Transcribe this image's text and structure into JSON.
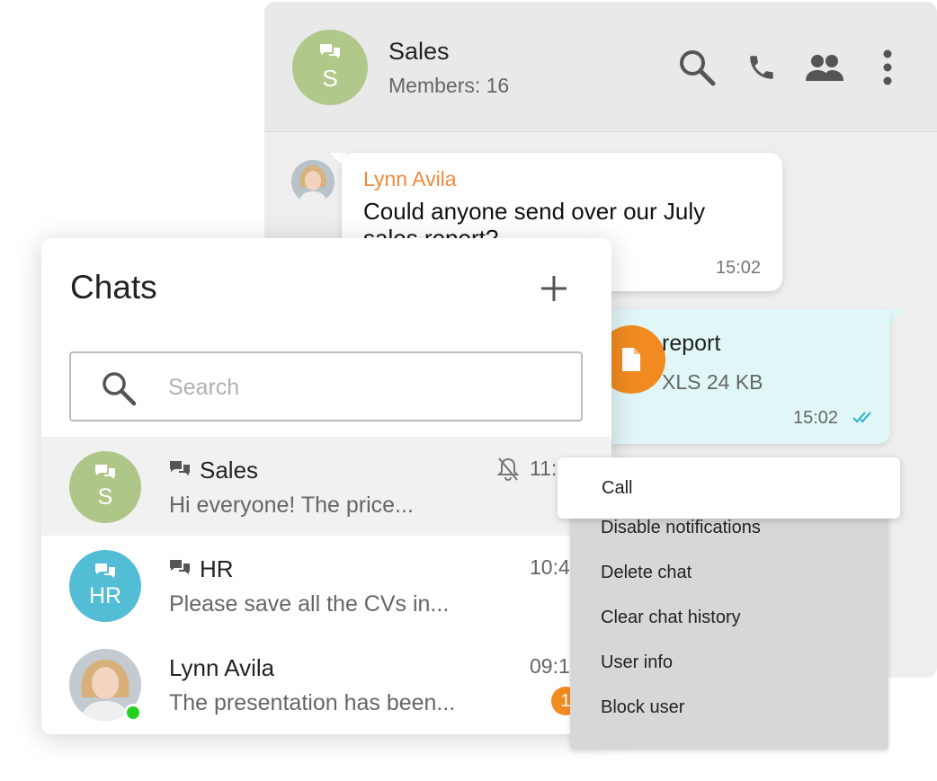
{
  "conversation": {
    "title": "Sales",
    "avatar_initial": "S",
    "members": "Members: 16",
    "avatar_color": "#b0c98a",
    "icons": [
      "search-icon",
      "phone-icon",
      "members-icon",
      "more-vertical-icon"
    ]
  },
  "messages": [
    {
      "sender": "Lynn Avila",
      "text": "Could anyone send over our July sales report?",
      "time": "15:02"
    }
  ],
  "file_message": {
    "name": "report",
    "meta": "XLS 24 KB",
    "time": "15:02",
    "status": "read"
  },
  "chats_panel": {
    "title": "Chats",
    "search_placeholder": "Search",
    "accent_color": "#f18a20"
  },
  "chats": [
    {
      "name": "Sales",
      "initial": "S",
      "preview": "Hi everyone! The price...",
      "time": "11:",
      "muted": true,
      "group": true
    },
    {
      "name": "HR",
      "initial": "HR",
      "preview": "Please save all the CVs in...",
      "time": "10:4",
      "group": true
    },
    {
      "name": "Lynn Avila",
      "preview": "The presentation has been...",
      "time": "09:1",
      "unread": "1",
      "online": true
    }
  ],
  "context_menu": {
    "items": [
      "Call",
      "Disable notifications",
      "Delete chat",
      "Clear chat history",
      "User info",
      "Block user"
    ]
  }
}
